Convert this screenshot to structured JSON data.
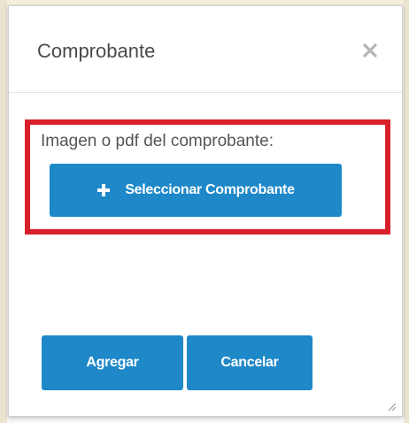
{
  "dialog": {
    "title": "Comprobante",
    "close_icon": "close-icon"
  },
  "upload": {
    "label": "Imagen o pdf del comprobante:",
    "button_label": "Seleccionar Comprobante",
    "button_icon": "plus-icon"
  },
  "footer": {
    "add_label": "Agregar",
    "cancel_label": "Cancelar"
  },
  "colors": {
    "primary": "#1e88c8",
    "highlight": "#d8202a",
    "title_text": "#4a4a4a"
  }
}
